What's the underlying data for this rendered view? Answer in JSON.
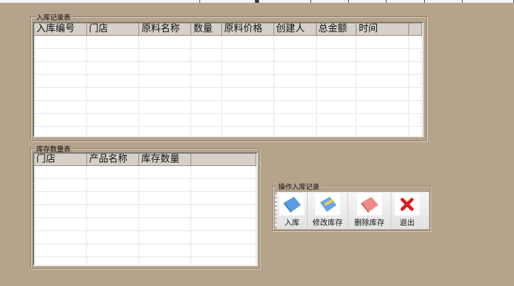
{
  "inbound_table": {
    "title": "入库记录表",
    "columns": [
      "入库编号",
      "门店",
      "原料名称",
      "数量",
      "原料价格",
      "创建人",
      "总金额",
      "时间"
    ]
  },
  "stock_table": {
    "title": "库存数量表",
    "columns": [
      "门店",
      "产品名称",
      "库存数量"
    ]
  },
  "operations": {
    "title": "操作入库记录",
    "buttons": [
      {
        "label": "入库",
        "icon": "book-blue-icon"
      },
      {
        "label": "修改库存",
        "icon": "edit-book-icon"
      },
      {
        "label": "删除库存",
        "icon": "book-red-icon"
      },
      {
        "label": "退出",
        "icon": "close-x-icon"
      }
    ]
  }
}
